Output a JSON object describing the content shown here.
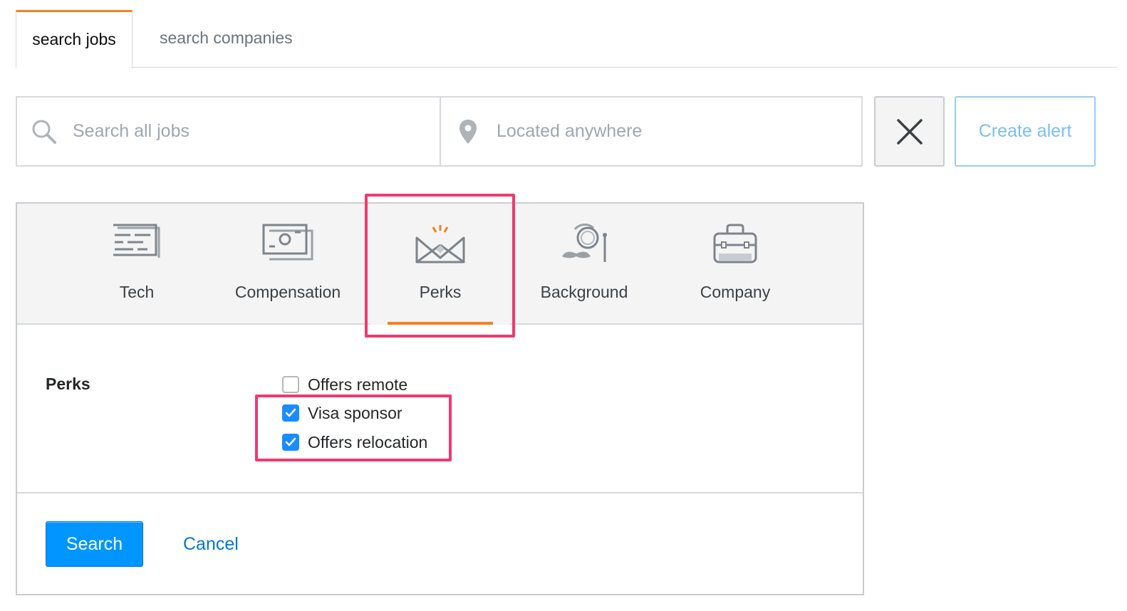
{
  "tabs": [
    {
      "label": "search jobs",
      "active": true
    },
    {
      "label": "search companies",
      "active": false
    }
  ],
  "search": {
    "jobs_placeholder": "Search all jobs",
    "location_placeholder": "Located anywhere",
    "search_icon": "magnifier-icon",
    "location_icon": "map-pin-icon"
  },
  "actions": {
    "clear_icon": "close-icon",
    "create_alert_label": "Create alert"
  },
  "categories": [
    {
      "label": "Tech",
      "icon": "code-window-icon",
      "active": false
    },
    {
      "label": "Compensation",
      "icon": "banknote-icon",
      "active": false
    },
    {
      "label": "Perks",
      "icon": "crown-icon",
      "active": true
    },
    {
      "label": "Background",
      "icon": "monocle-mustache-icon",
      "active": false
    },
    {
      "label": "Company",
      "icon": "briefcase-icon",
      "active": false
    }
  ],
  "perks": {
    "section_label": "Perks",
    "options": [
      {
        "label": "Offers remote",
        "checked": false
      },
      {
        "label": "Visa sponsor",
        "checked": true
      },
      {
        "label": "Offers relocation",
        "checked": true
      }
    ]
  },
  "footer": {
    "search_label": "Search",
    "cancel_label": "Cancel"
  },
  "colors": {
    "accent": "#f48024",
    "primary_button": "#0095ff",
    "link": "#0077cc",
    "annotation": "#f0396e",
    "checkbox_checked": "#1a8cff"
  }
}
